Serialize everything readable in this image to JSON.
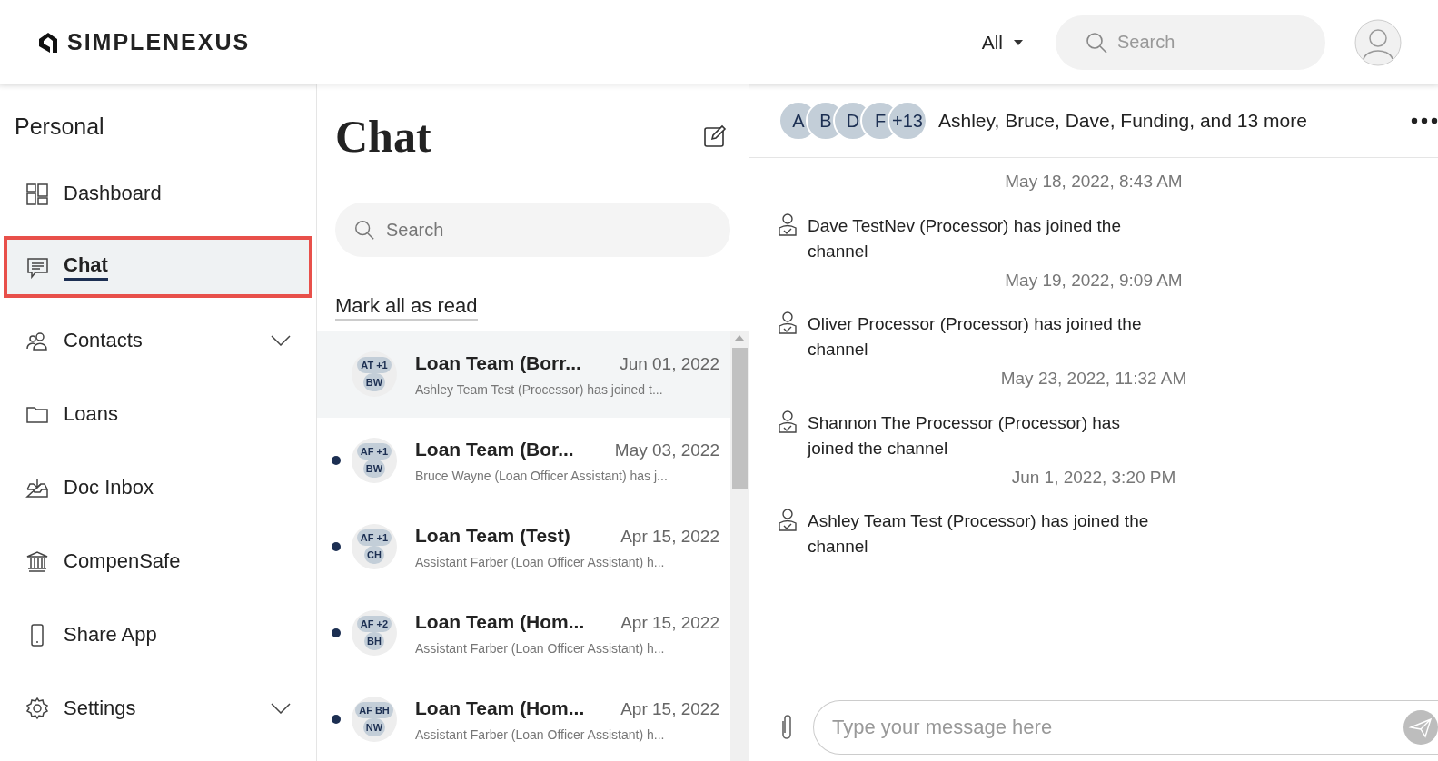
{
  "header": {
    "logo": "SIMPLENEXUS",
    "filter": "All",
    "search": {
      "placeholder": "Search"
    }
  },
  "sidebar": {
    "title": "Personal",
    "items": [
      {
        "kind": "dashboard",
        "label": "Dashboard",
        "selected": false,
        "expandable": false
      },
      {
        "kind": "chat",
        "label": "Chat",
        "selected": true,
        "expandable": false
      },
      {
        "kind": "contacts",
        "label": "Contacts",
        "selected": false,
        "expandable": true
      },
      {
        "kind": "folder",
        "label": "Loans",
        "selected": false,
        "expandable": false
      },
      {
        "kind": "inbox",
        "label": "Doc Inbox",
        "selected": false,
        "expandable": false
      },
      {
        "kind": "bank",
        "label": "CompenSafe",
        "selected": false,
        "expandable": false
      },
      {
        "kind": "phone",
        "label": "Share App",
        "selected": false,
        "expandable": false
      },
      {
        "kind": "settings",
        "label": "Settings",
        "selected": false,
        "expandable": true
      }
    ]
  },
  "chat_list": {
    "title": "Chat",
    "search": {
      "placeholder": "Search"
    },
    "mark_all": "Mark all as read",
    "conversations": [
      {
        "top": "AT +1",
        "bottom": "BW",
        "title": "Loan Team (Borr...",
        "date": "Jun 01, 2022",
        "preview": "Ashley Team Test (Processor) has joined t...",
        "selected": true,
        "unread": false
      },
      {
        "top": "AF +1",
        "bottom": "BW",
        "title": "Loan Team (Bor...",
        "date": "May 03, 2022",
        "preview": "Bruce Wayne (Loan Officer Assistant) has j...",
        "selected": false,
        "unread": true
      },
      {
        "top": "AF +1",
        "bottom": "CH",
        "title": "Loan Team (Test)",
        "date": "Apr 15, 2022",
        "preview": "Assistant Farber (Loan Officer Assistant) h...",
        "selected": false,
        "unread": true
      },
      {
        "top": "AF +2",
        "bottom": "BH",
        "title": "Loan Team (Hom...",
        "date": "Apr 15, 2022",
        "preview": "Assistant Farber (Loan Officer Assistant) h...",
        "selected": false,
        "unread": true
      },
      {
        "top": "AF BH",
        "bottom": "NW",
        "title": "Loan Team (Hom...",
        "date": "Apr 15, 2022",
        "preview": "Assistant Farber (Loan Officer Assistant) h...",
        "selected": false,
        "unread": true
      }
    ]
  },
  "conversation": {
    "avatars": [
      "A",
      "B",
      "D",
      "F",
      "+13"
    ],
    "members": "Ashley, Bruce, Dave, Funding, and 13 more",
    "messages": [
      {
        "time": "May 18, 2022, 8:43 AM",
        "text": "Dave TestNev (Processor) has joined the channel"
      },
      {
        "time": "May 19, 2022, 9:09 AM",
        "text": "Oliver Processor (Processor) has joined the channel"
      },
      {
        "time": "May 23, 2022, 11:32 AM",
        "text": "Shannon The Processor (Processor) has joined the channel"
      },
      {
        "time": "Jun 1, 2022, 3:20 PM",
        "text": "Ashley Team Test (Processor) has joined the channel"
      }
    ],
    "composer": {
      "placeholder": "Type your message here"
    }
  }
}
